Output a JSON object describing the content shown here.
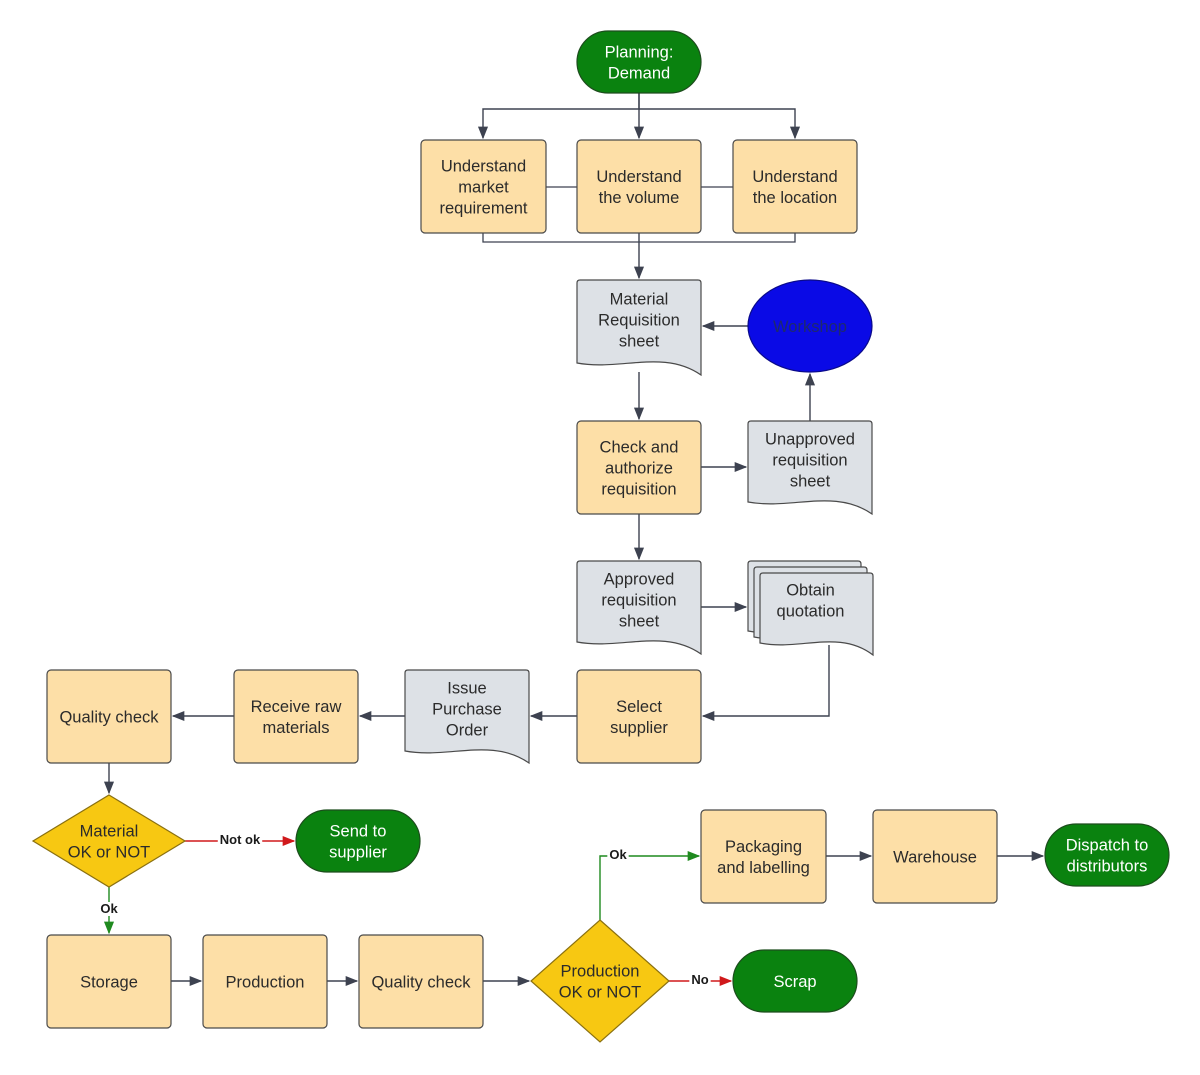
{
  "colors": {
    "process": "#fddfa7",
    "document": "#dde1e6",
    "terminal": "#0a820f",
    "decision": "#f7c812",
    "workshop": "#0a0ae6",
    "line": "#3d4250",
    "ok_line": "#1f8a1f",
    "no_line": "#d0191b"
  },
  "nodes": {
    "planning": {
      "type": "terminal",
      "lines": [
        "Planning:",
        "Demand"
      ]
    },
    "u_market": {
      "type": "process",
      "lines": [
        "Understand",
        "market",
        "requirement"
      ]
    },
    "u_volume": {
      "type": "process",
      "lines": [
        "Understand",
        "the volume"
      ]
    },
    "u_location": {
      "type": "process",
      "lines": [
        "Understand",
        "the location"
      ]
    },
    "mrs": {
      "type": "document",
      "lines": [
        "Material",
        "Requisition",
        "sheet"
      ]
    },
    "workshop": {
      "type": "ellipse",
      "lines": [
        "Workshop"
      ]
    },
    "check": {
      "type": "process",
      "lines": [
        "Check and",
        "authorize",
        "requisition"
      ]
    },
    "unapproved": {
      "type": "document",
      "lines": [
        "Unapproved",
        "requisition",
        "sheet"
      ]
    },
    "approved": {
      "type": "document",
      "lines": [
        "Approved",
        "requisition",
        "sheet"
      ]
    },
    "quotation": {
      "type": "multidocument",
      "lines": [
        "Obtain",
        "quotation"
      ]
    },
    "select": {
      "type": "process",
      "lines": [
        "Select",
        "supplier"
      ]
    },
    "issue_po": {
      "type": "document",
      "lines": [
        "Issue",
        "Purchase",
        "Order"
      ]
    },
    "receive": {
      "type": "process",
      "lines": [
        "Receive raw",
        "materials"
      ]
    },
    "qc1": {
      "type": "process",
      "lines": [
        "Quality check"
      ]
    },
    "material_decision": {
      "type": "decision",
      "lines": [
        "Material",
        "OK or NOT"
      ]
    },
    "send_supplier": {
      "type": "terminal",
      "lines": [
        "Send to",
        "supplier"
      ]
    },
    "storage": {
      "type": "process",
      "lines": [
        "Storage"
      ]
    },
    "production": {
      "type": "process",
      "lines": [
        "Production"
      ]
    },
    "qc2": {
      "type": "process",
      "lines": [
        "Quality check"
      ]
    },
    "production_decision": {
      "type": "decision",
      "lines": [
        "Production",
        "OK or NOT"
      ]
    },
    "scrap": {
      "type": "terminal",
      "lines": [
        "Scrap"
      ]
    },
    "packaging": {
      "type": "process",
      "lines": [
        "Packaging",
        "and labelling"
      ]
    },
    "warehouse": {
      "type": "process",
      "lines": [
        "Warehouse"
      ]
    },
    "dispatch": {
      "type": "terminal",
      "lines": [
        "Dispatch to",
        "distributors"
      ]
    }
  },
  "edges": [
    {
      "from": "planning",
      "to": "u_market"
    },
    {
      "from": "planning",
      "to": "u_volume"
    },
    {
      "from": "planning",
      "to": "u_location"
    },
    {
      "from": "u_volume",
      "to": "mrs"
    },
    {
      "from": "workshop",
      "to": "mrs"
    },
    {
      "from": "mrs",
      "to": "check"
    },
    {
      "from": "check",
      "to": "unapproved"
    },
    {
      "from": "unapproved",
      "to": "workshop"
    },
    {
      "from": "check",
      "to": "approved"
    },
    {
      "from": "approved",
      "to": "quotation"
    },
    {
      "from": "quotation",
      "to": "select"
    },
    {
      "from": "select",
      "to": "issue_po"
    },
    {
      "from": "issue_po",
      "to": "receive"
    },
    {
      "from": "receive",
      "to": "qc1"
    },
    {
      "from": "qc1",
      "to": "material_decision"
    },
    {
      "from": "material_decision",
      "to": "send_supplier",
      "label": "Not ok",
      "kind": "no"
    },
    {
      "from": "material_decision",
      "to": "storage",
      "label": "Ok",
      "kind": "ok"
    },
    {
      "from": "storage",
      "to": "production"
    },
    {
      "from": "production",
      "to": "qc2"
    },
    {
      "from": "qc2",
      "to": "production_decision"
    },
    {
      "from": "production_decision",
      "to": "packaging",
      "label": "Ok",
      "kind": "ok"
    },
    {
      "from": "production_decision",
      "to": "scrap",
      "label": "No",
      "kind": "no"
    },
    {
      "from": "packaging",
      "to": "warehouse"
    },
    {
      "from": "warehouse",
      "to": "dispatch"
    }
  ]
}
